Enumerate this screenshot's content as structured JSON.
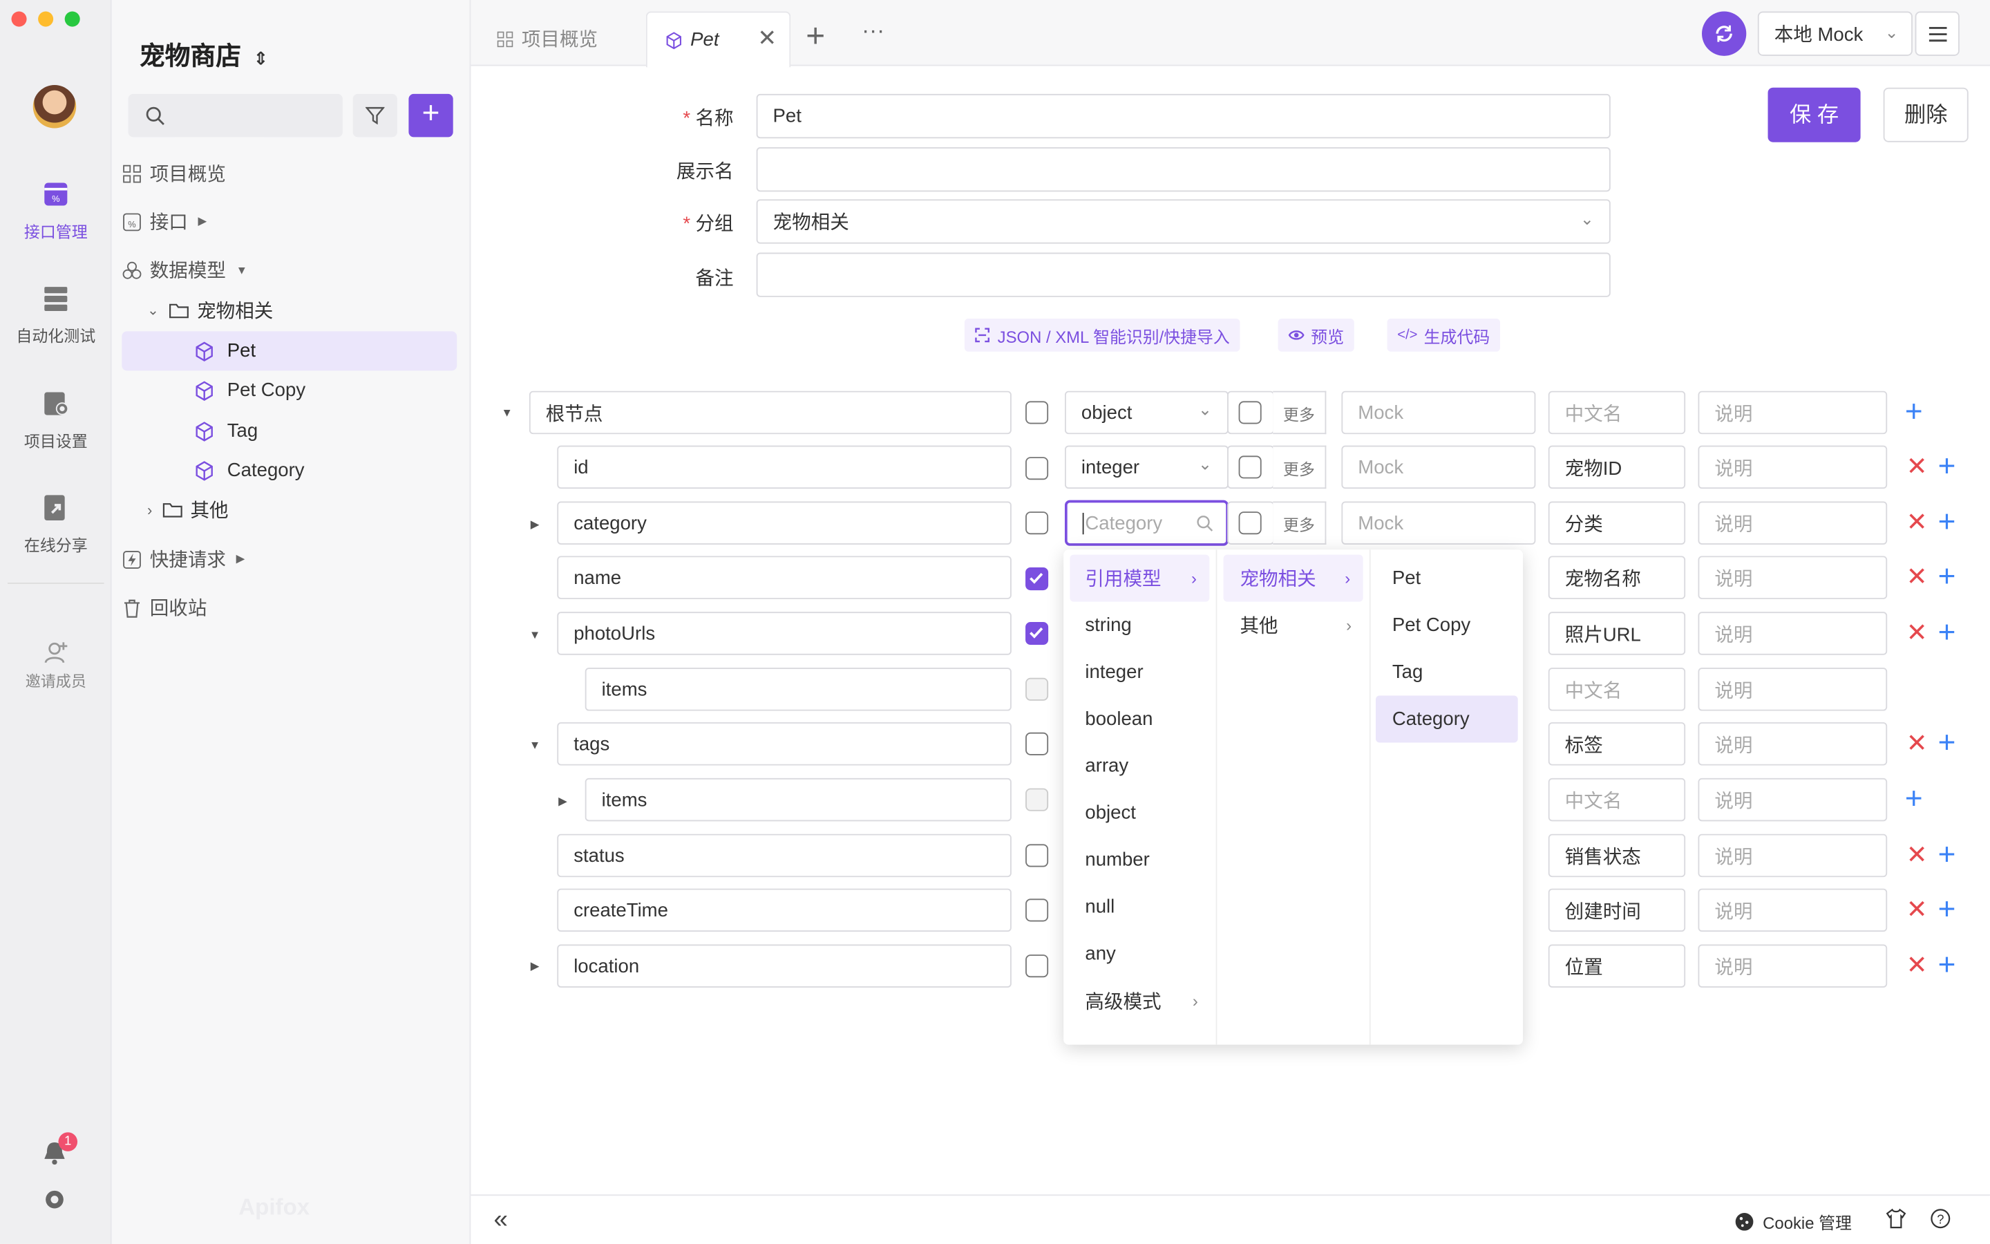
{
  "project": {
    "name": "宠物商店"
  },
  "rail": {
    "items": [
      {
        "label": "接口管理",
        "icon": "api-icon",
        "active": true
      },
      {
        "label": "自动化测试",
        "icon": "test-icon"
      },
      {
        "label": "项目设置",
        "icon": "settings-icon"
      },
      {
        "label": "在线分享",
        "icon": "share-icon"
      },
      {
        "label": "邀请成员",
        "icon": "invite-icon"
      }
    ],
    "notification_count": "1"
  },
  "sidebar": {
    "overview": "项目概览",
    "api": "接口",
    "models": "数据模型",
    "group_pet": "宠物相关",
    "model_items": [
      "Pet",
      "Pet Copy",
      "Tag",
      "Category"
    ],
    "group_other": "其他",
    "quick": "快捷请求",
    "trash": "回收站",
    "watermark": "Apifox"
  },
  "tabs": {
    "overview": "项目概览",
    "active": "Pet"
  },
  "env": {
    "selected": "本地 Mock"
  },
  "form": {
    "name_label": "名称",
    "name_value": "Pet",
    "display_label": "展示名",
    "display_value": "",
    "group_label": "分组",
    "group_value": "宠物相关",
    "note_label": "备注",
    "note_value": "",
    "save": "保 存",
    "delete": "删除"
  },
  "actions": {
    "import": "JSON / XML 智能识别/快捷导入",
    "preview": "预览",
    "codegen": "生成代码"
  },
  "placeholders": {
    "mock": "Mock",
    "cn": "中文名",
    "desc": "说明",
    "more": "更多",
    "type_search": "Category"
  },
  "rows": [
    {
      "name": "根节点",
      "type": "object",
      "cn": "",
      "required": false
    },
    {
      "name": "id",
      "type": "integer",
      "cn": "宠物ID",
      "required": false
    },
    {
      "name": "category",
      "type": "",
      "cn": "分类",
      "required": false
    },
    {
      "name": "name",
      "type": "",
      "cn": "宠物名称",
      "required": true
    },
    {
      "name": "photoUrls",
      "type": "",
      "cn": "照片URL",
      "required": true
    },
    {
      "name": "items",
      "type": "",
      "cn": "",
      "required": false
    },
    {
      "name": "tags",
      "type": "",
      "cn": "标签",
      "required": false
    },
    {
      "name": "items",
      "type": "",
      "cn": "",
      "required": false
    },
    {
      "name": "status",
      "type": "",
      "cn": "销售状态",
      "required": false
    },
    {
      "name": "createTime",
      "type": "",
      "cn": "创建时间",
      "required": false
    },
    {
      "name": "location",
      "type": "",
      "cn": "位置",
      "required": false
    }
  ],
  "dropdown": {
    "types": [
      "引用模型",
      "string",
      "integer",
      "boolean",
      "array",
      "object",
      "number",
      "null",
      "any",
      "高级模式"
    ],
    "groups": [
      "宠物相关",
      "其他"
    ],
    "models": [
      "Pet",
      "Pet Copy",
      "Tag",
      "Category"
    ]
  },
  "footer": {
    "cookie": "Cookie 管理"
  },
  "colors": {
    "accent": "#7b4fe0",
    "danger": "#e5484d",
    "blue": "#3b82f6"
  }
}
